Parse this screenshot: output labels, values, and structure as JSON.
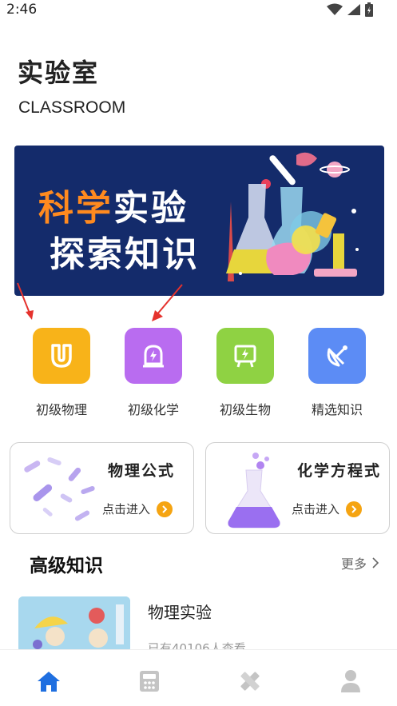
{
  "status_bar": {
    "time": "2:46"
  },
  "header": {
    "title": "实验室",
    "subtitle": "CLASSROOM"
  },
  "banner": {
    "line1_accent": "科学",
    "line1_rest": "实验",
    "line2": "探索知识"
  },
  "categories": [
    {
      "label": "初级物理",
      "color": "#f8b319",
      "icon": "magnet-icon"
    },
    {
      "label": "初级化学",
      "color": "#b96cf0",
      "icon": "alarm-light-icon"
    },
    {
      "label": "初级生物",
      "color": "#8fd243",
      "icon": "board-bolt-icon"
    },
    {
      "label": "精选知识",
      "color": "#5c8cf5",
      "icon": "satellite-dish-icon"
    }
  ],
  "cards": [
    {
      "title": "物理公式",
      "enter": "点击进入"
    },
    {
      "title": "化学方程式",
      "enter": "点击进入"
    }
  ],
  "section": {
    "title": "高级知识",
    "more": "更多"
  },
  "list_item": {
    "title": "物理实验",
    "meta": "已有40106人查看"
  },
  "tabs": [
    {
      "icon": "home-icon",
      "active": true
    },
    {
      "icon": "calculator-icon",
      "active": false
    },
    {
      "icon": "pencil-ruler-icon",
      "active": false
    },
    {
      "icon": "profile-icon",
      "active": false
    }
  ],
  "colors": {
    "accent": "#1f6fe0",
    "orange": "#ff8a1f",
    "banner_bg": "#142b6b",
    "arrow_red": "#e5322d"
  }
}
